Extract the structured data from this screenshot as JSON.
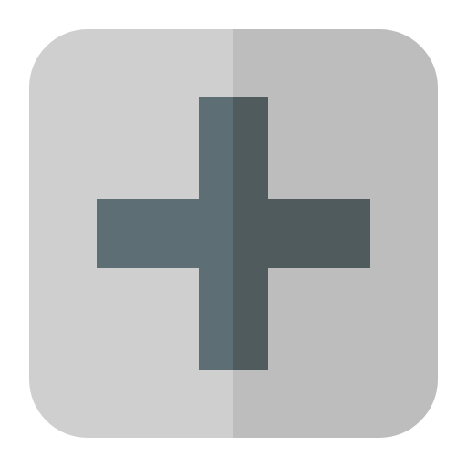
{
  "icon": {
    "name": "plus-icon",
    "colors": {
      "tile_left": "#cfcfcf",
      "tile_right": "#bdbdbd",
      "cross_left": "#5d6e74",
      "cross_right": "#4f5b5d",
      "background": "#ffffff"
    }
  }
}
